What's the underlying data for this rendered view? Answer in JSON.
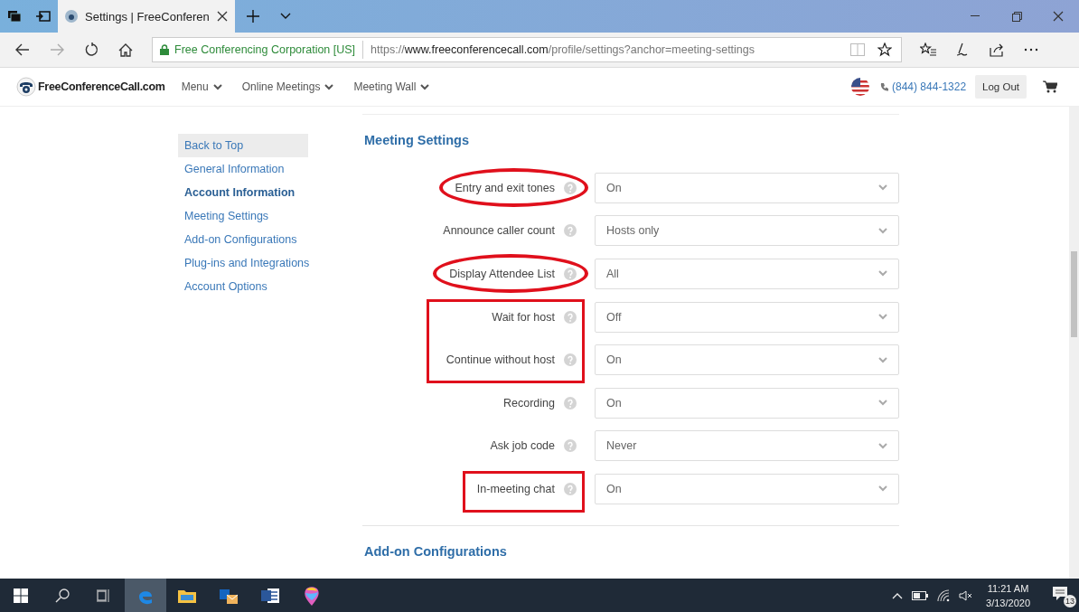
{
  "browser": {
    "tab_title": "Settings | FreeConferen",
    "identity": "Free Conferencing Corporation [US]",
    "url": {
      "scheme": "https://",
      "host": "www.freeconferencecall.com",
      "path": "/profile/settings?anchor=meeting-settings"
    }
  },
  "site_nav": {
    "logo": "FreeConferenceCall.com",
    "menus": [
      "Menu",
      "Online Meetings",
      "Meeting Wall"
    ],
    "phone": "(844) 844-1322",
    "logout": "Log Out"
  },
  "sidebar": {
    "items": [
      {
        "label": "Back to Top",
        "selected": false,
        "hovered": true
      },
      {
        "label": "General Information",
        "selected": false,
        "hovered": false
      },
      {
        "label": "Account Information",
        "selected": true,
        "hovered": false
      },
      {
        "label": "Meeting Settings",
        "selected": false,
        "hovered": false
      },
      {
        "label": "Add-on Configurations",
        "selected": false,
        "hovered": false
      },
      {
        "label": "Plug-ins and Integrations",
        "selected": false,
        "hovered": false
      },
      {
        "label": "Account Options",
        "selected": false,
        "hovered": false
      }
    ]
  },
  "section": {
    "title": "Meeting Settings",
    "settings": [
      {
        "label": "Entry and exit tones",
        "value": "On",
        "circled": true,
        "boxed": false
      },
      {
        "label": "Announce caller count",
        "value": "Hosts only",
        "circled": false,
        "boxed": false
      },
      {
        "label": "Display Attendee List",
        "value": "All",
        "circled": true,
        "boxed": false
      },
      {
        "label": "Wait for host",
        "value": "Off",
        "circled": false,
        "boxed": true
      },
      {
        "label": "Continue without host",
        "value": "On",
        "circled": false,
        "boxed": true
      },
      {
        "label": "Recording",
        "value": "On",
        "circled": false,
        "boxed": false
      },
      {
        "label": "Ask job code",
        "value": "Never",
        "circled": false,
        "boxed": false
      },
      {
        "label": "In-meeting chat",
        "value": "On",
        "circled": false,
        "boxed": true
      }
    ]
  },
  "next_section": {
    "title": "Add-on Configurations"
  },
  "taskbar": {
    "time": "11:21 AM",
    "date": "3/13/2020",
    "notifications": "13"
  }
}
